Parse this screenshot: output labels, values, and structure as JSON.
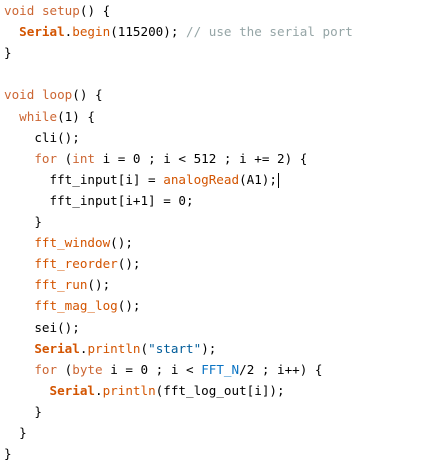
{
  "editor": {
    "lines": [
      [
        {
          "c": "tok-kw",
          "t": "void"
        },
        {
          "c": "tok-txt",
          "t": " "
        },
        {
          "c": "tok-kw",
          "t": "setup"
        },
        {
          "c": "tok-txt",
          "t": "() {"
        }
      ],
      [
        {
          "c": "tok-txt",
          "t": "  "
        },
        {
          "c": "tok-obj",
          "t": "Serial"
        },
        {
          "c": "tok-txt",
          "t": "."
        },
        {
          "c": "tok-fn",
          "t": "begin"
        },
        {
          "c": "tok-txt",
          "t": "(115200); "
        },
        {
          "c": "tok-cm",
          "t": "// use the serial port"
        }
      ],
      [
        {
          "c": "tok-txt",
          "t": "}"
        }
      ],
      [],
      [
        {
          "c": "tok-kw",
          "t": "void"
        },
        {
          "c": "tok-txt",
          "t": " "
        },
        {
          "c": "tok-kw",
          "t": "loop"
        },
        {
          "c": "tok-txt",
          "t": "() {"
        }
      ],
      [
        {
          "c": "tok-txt",
          "t": "  "
        },
        {
          "c": "tok-kw",
          "t": "while"
        },
        {
          "c": "tok-txt",
          "t": "(1) {"
        }
      ],
      [
        {
          "c": "tok-txt",
          "t": "    cli();"
        }
      ],
      [
        {
          "c": "tok-txt",
          "t": "    "
        },
        {
          "c": "tok-kw",
          "t": "for"
        },
        {
          "c": "tok-txt",
          "t": " ("
        },
        {
          "c": "tok-type",
          "t": "int"
        },
        {
          "c": "tok-txt",
          "t": " i = 0 ; i < 512 ; i += 2) {"
        }
      ],
      [
        {
          "c": "tok-txt",
          "t": "      fft_input[i] = "
        },
        {
          "c": "tok-fn",
          "t": "analogRead"
        },
        {
          "c": "tok-txt",
          "t": "(A1);"
        },
        {
          "c": "caret",
          "t": ""
        }
      ],
      [
        {
          "c": "tok-txt",
          "t": "      fft_input[i+1] = 0;"
        }
      ],
      [
        {
          "c": "tok-txt",
          "t": "    }"
        }
      ],
      [
        {
          "c": "tok-txt",
          "t": "    "
        },
        {
          "c": "tok-fn",
          "t": "fft_window"
        },
        {
          "c": "tok-txt",
          "t": "();"
        }
      ],
      [
        {
          "c": "tok-txt",
          "t": "    "
        },
        {
          "c": "tok-fn",
          "t": "fft_reorder"
        },
        {
          "c": "tok-txt",
          "t": "();"
        }
      ],
      [
        {
          "c": "tok-txt",
          "t": "    "
        },
        {
          "c": "tok-fn",
          "t": "fft_run"
        },
        {
          "c": "tok-txt",
          "t": "();"
        }
      ],
      [
        {
          "c": "tok-txt",
          "t": "    "
        },
        {
          "c": "tok-fn",
          "t": "fft_mag_log"
        },
        {
          "c": "tok-txt",
          "t": "();"
        }
      ],
      [
        {
          "c": "tok-txt",
          "t": "    sei();"
        }
      ],
      [
        {
          "c": "tok-txt",
          "t": "    "
        },
        {
          "c": "tok-obj",
          "t": "Serial"
        },
        {
          "c": "tok-txt",
          "t": "."
        },
        {
          "c": "tok-fn",
          "t": "println"
        },
        {
          "c": "tok-txt",
          "t": "("
        },
        {
          "c": "tok-str",
          "t": "\"start\""
        },
        {
          "c": "tok-txt",
          "t": ");"
        }
      ],
      [
        {
          "c": "tok-txt",
          "t": "    "
        },
        {
          "c": "tok-kw",
          "t": "for"
        },
        {
          "c": "tok-txt",
          "t": " ("
        },
        {
          "c": "tok-type",
          "t": "byte"
        },
        {
          "c": "tok-txt",
          "t": " i = 0 ; i < "
        },
        {
          "c": "tok-const",
          "t": "FFT_N"
        },
        {
          "c": "tok-txt",
          "t": "/2 ; i++) {"
        }
      ],
      [
        {
          "c": "tok-txt",
          "t": "      "
        },
        {
          "c": "tok-obj",
          "t": "Serial"
        },
        {
          "c": "tok-txt",
          "t": "."
        },
        {
          "c": "tok-fn",
          "t": "println"
        },
        {
          "c": "tok-txt",
          "t": "(fft_log_out[i]);"
        }
      ],
      [
        {
          "c": "tok-txt",
          "t": "    }"
        }
      ],
      [
        {
          "c": "tok-txt",
          "t": "  }"
        }
      ],
      [
        {
          "c": "tok-txt",
          "t": "}"
        }
      ]
    ],
    "colors": {
      "keyword": "#cc6633",
      "function": "#d35400",
      "constant": "#0b74c4",
      "comment": "#95a5a6",
      "string": "#005c99",
      "text": "#000000",
      "background": "#ffffff"
    }
  }
}
